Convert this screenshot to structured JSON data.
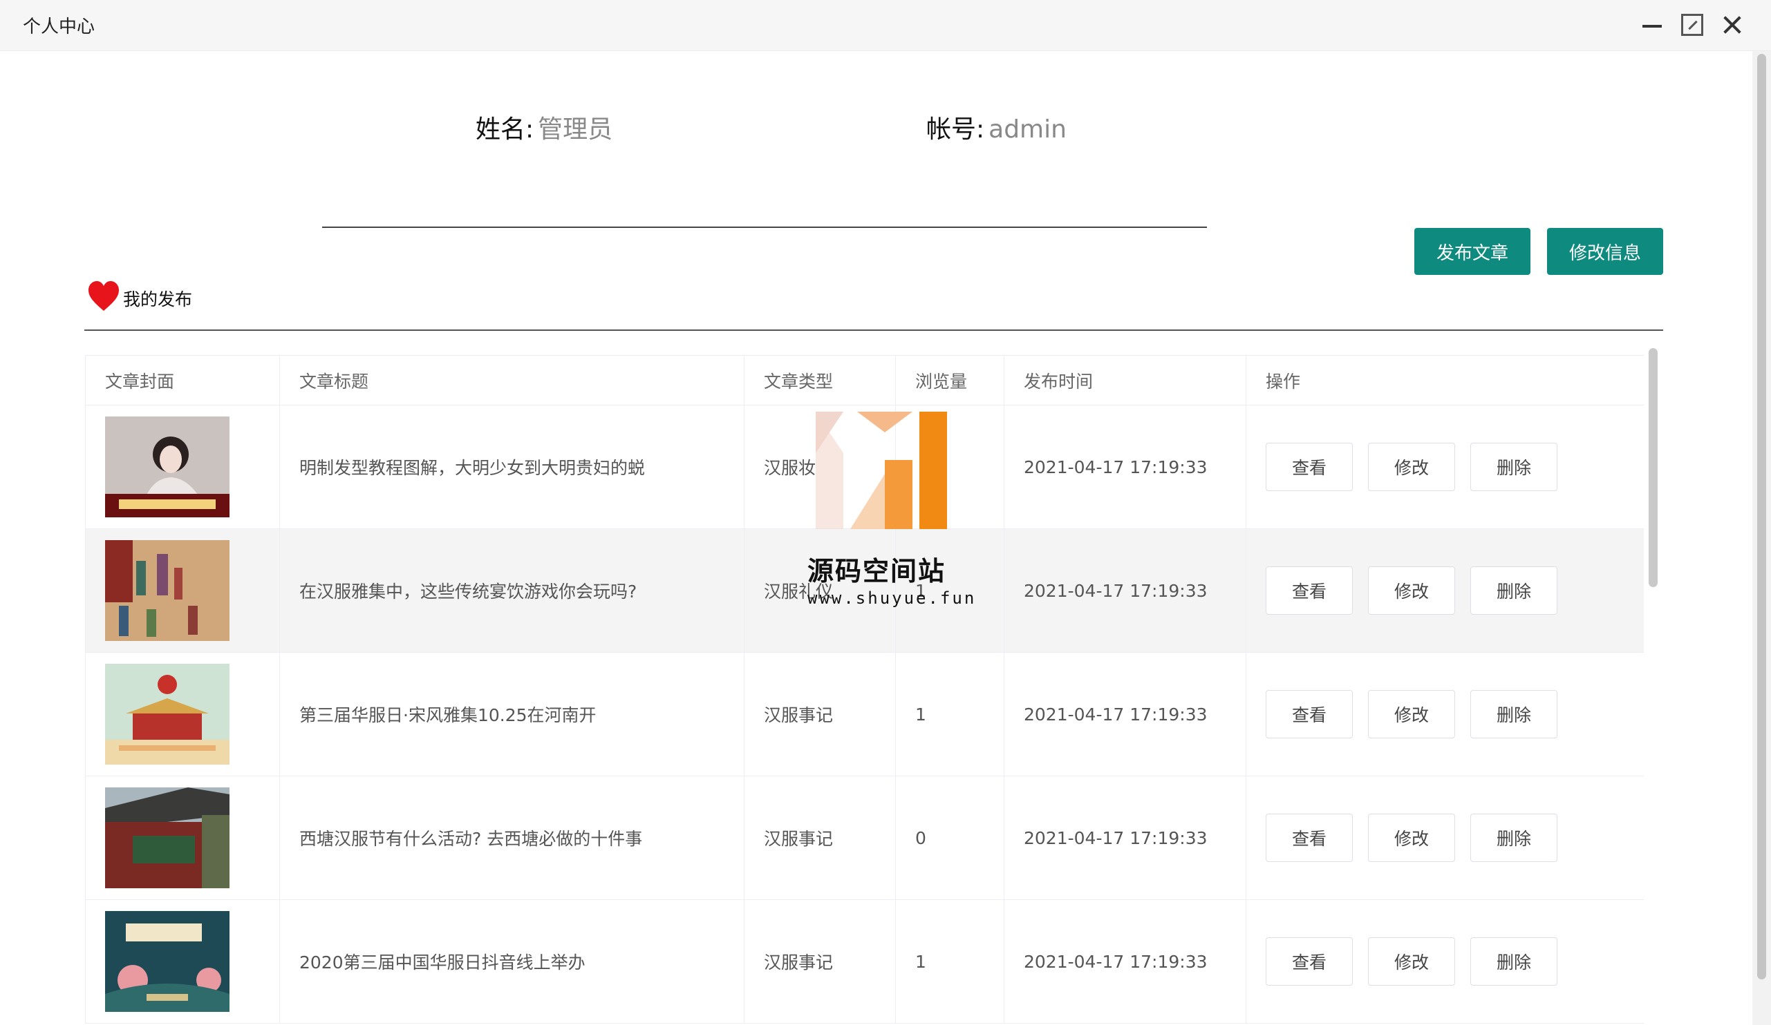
{
  "window": {
    "title": "个人中心"
  },
  "profile": {
    "name_label": "姓名:",
    "name_value": "管理员",
    "account_label": "帐号:",
    "account_value": "admin"
  },
  "actions": {
    "publish": "发布文章",
    "edit_info": "修改信息"
  },
  "section": {
    "title": "我的发布"
  },
  "table": {
    "headers": [
      "文章封面",
      "文章标题",
      "文章类型",
      "浏览量",
      "发布时间",
      "操作"
    ],
    "rows": [
      {
        "title": "明制发型教程图解，大明少女到大明贵妇的蜕",
        "type": "汉服妆",
        "views": "",
        "time": "2021-04-17 17:19:33"
      },
      {
        "title": "在汉服雅集中，这些传统宴饮游戏你会玩吗?",
        "type": "汉服礼仪",
        "views": "1",
        "time": "2021-04-17 17:19:33"
      },
      {
        "title": "第三届华服日·宋风雅集10.25在河南开",
        "type": "汉服事记",
        "views": "1",
        "time": "2021-04-17 17:19:33"
      },
      {
        "title": "西塘汉服节有什么活动? 去西塘必做的十件事",
        "type": "汉服事记",
        "views": "0",
        "time": "2021-04-17 17:19:33"
      },
      {
        "title": "2020第三届中国华服日抖音线上举办",
        "type": "汉服事记",
        "views": "1",
        "time": "2021-04-17 17:19:33"
      }
    ],
    "op_labels": {
      "view": "查看",
      "edit": "修改",
      "delete": "删除"
    }
  },
  "watermark": {
    "name": "源码空间站",
    "url": "www.shuyue.fun"
  },
  "colors": {
    "accent": "#0e8a7f",
    "heart": "#e8141b"
  }
}
